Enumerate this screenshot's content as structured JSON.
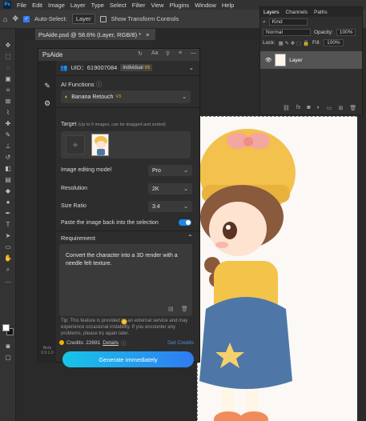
{
  "menubar": {
    "logo": "Ps",
    "items": [
      "File",
      "Edit",
      "Image",
      "Layer",
      "Type",
      "Select",
      "Filter",
      "View",
      "Plugins",
      "Window",
      "Help"
    ]
  },
  "optionsbar": {
    "auto_select_label": "Auto-Select:",
    "auto_select_value": "Layer",
    "transform_label": "Show Transform Controls"
  },
  "document_tab": {
    "title": "PsAide.psd @ 58.6% (Layer, RGB/8) *",
    "close": "×"
  },
  "layers_panel": {
    "tabs": [
      "Layers",
      "Channels",
      "Paths"
    ],
    "filter_value": "Kind",
    "blend_mode": "Normal",
    "opacity_label": "Opacity:",
    "opacity_value": "100%",
    "lock_label": "Lock:",
    "fill_label": "Fill:",
    "fill_value": "100%",
    "layer_name": "Layer"
  },
  "plugin": {
    "title": "PsAide",
    "uid_label": "UID：619007084",
    "plan_badge": "Individual",
    "plan_tier": "V3",
    "ai_functions_label": "AI Functions",
    "function_value": "Banana Retouch",
    "function_tier": "V3",
    "target_label": "Target",
    "target_hint": "(Up to 5 images, can be dragged and sorted)",
    "model_label": "Image editing model",
    "model_value": "Pro",
    "resolution_label": "Resolution",
    "resolution_value": "2K",
    "ratio_label": "Size Ratio",
    "ratio_value": "3:4",
    "paste_label": "Paste the image back into the selection",
    "paste_enabled": true,
    "requirement_label": "Requirement",
    "requirement_text": "Convert the character into a 3D render with a needle felt texture.",
    "tip_text": "Tip: This feature is provided by an external service and may experience occasional instability. If you encounter any problems, please try again later.",
    "credits_label": "Credits: 22691",
    "details_label": "Details",
    "get_credits_label": "Get Credits",
    "generate_label": "Generate immediately",
    "version_text": "Beta 0.9.1.0"
  },
  "colors": {
    "accent": "#2f7cf2",
    "accent_start": "#18c4e8",
    "toggle_on": "#1e88e5",
    "vip_gold": "#f5a623"
  }
}
